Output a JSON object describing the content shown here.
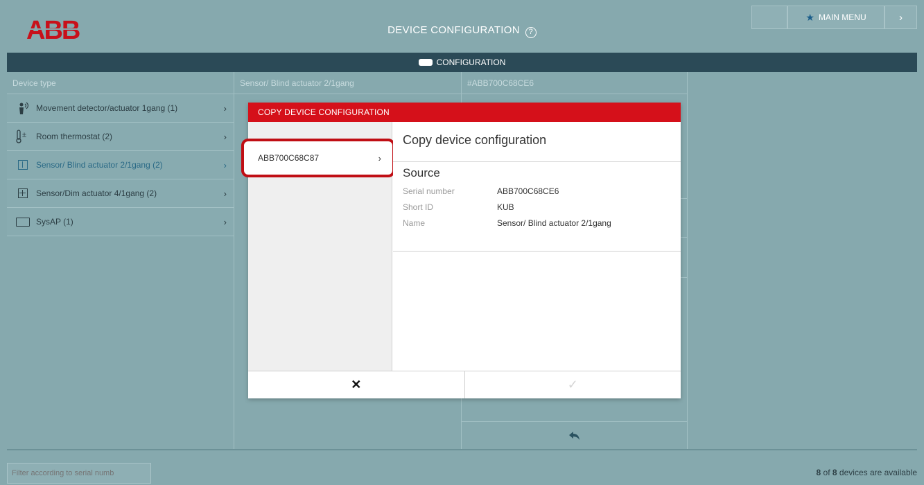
{
  "header": {
    "logo_text": "ABB",
    "title": "DEVICE CONFIGURATION",
    "help_icon": "question-circle-icon",
    "main_menu_label": "MAIN MENU",
    "main_menu_icon": "star-icon",
    "next_icon": "chevron-right-icon"
  },
  "config_bar": {
    "label": "CONFIGURATION",
    "icon": "tag-icon"
  },
  "columns": {
    "device_type_header": "Device type",
    "device_header": "Sensor/ Blind actuator 2/1gang",
    "serial_header": "#ABB700C68CE6"
  },
  "device_types": [
    {
      "label": "Movement detector/actuator 1gang (1)",
      "icon": "movement-detector-icon",
      "selected": false
    },
    {
      "label": "Room thermostat (2)",
      "icon": "thermostat-icon",
      "selected": false
    },
    {
      "label": "Sensor/ Blind actuator 2/1gang (2)",
      "icon": "blind-actuator-icon",
      "selected": true
    },
    {
      "label": "Sensor/Dim actuator 4/1gang (2)",
      "icon": "dim-actuator-icon",
      "selected": false
    },
    {
      "label": "SysAP (1)",
      "icon": "sysap-icon",
      "selected": false
    }
  ],
  "modal": {
    "title": "COPY DEVICE CONFIGURATION",
    "device_item": "ABB700C68C87",
    "heading": "Copy device configuration",
    "source_heading": "Source",
    "fields": [
      {
        "label": "Serial number",
        "value": "ABB700C68CE6"
      },
      {
        "label": "Short ID",
        "value": "KUB"
      },
      {
        "label": "Name",
        "value": "Sensor/ Blind actuator 2/1gang"
      }
    ],
    "cancel_icon": "close-icon",
    "confirm_icon": "checkmark-icon"
  },
  "footer": {
    "filter_placeholder": "Filter according to serial numb",
    "count_bold": "8",
    "count_mid": " of ",
    "count_total": "8",
    "count_suffix": " devices are available"
  },
  "colors": {
    "brand_red": "#d5101a",
    "highlight_red": "#c00e14",
    "bar_dark": "#2b4a57",
    "background": "#86a9ae"
  }
}
